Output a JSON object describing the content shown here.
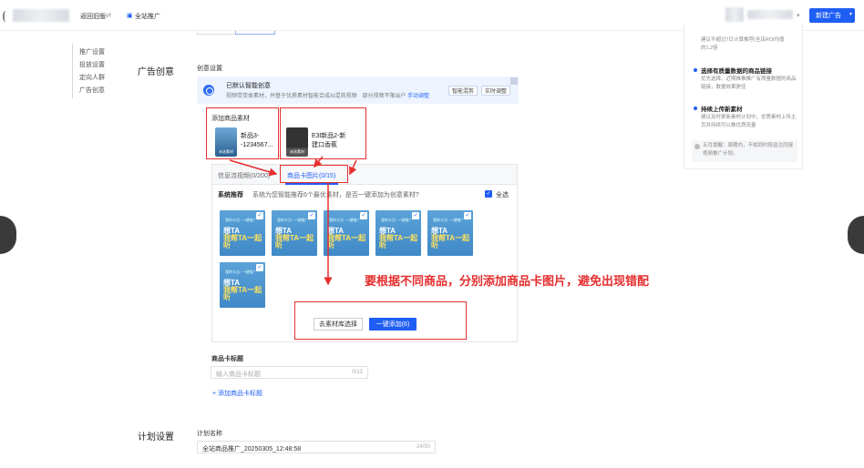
{
  "topbar": {
    "back_label": "返回旧版",
    "scope_label": "全站推广",
    "new_ad_label": "新建广告",
    "dropdown_caret": "▾"
  },
  "nav": {
    "items": [
      "推广设置",
      "投放设置",
      "定向人群",
      "广告创意"
    ]
  },
  "sections": {
    "ad_creative_title": "广告创意",
    "creative_settings_label": "创意设置",
    "plan_settings_title": "计划设置"
  },
  "smart_banner": {
    "title": "已默认智能创意",
    "desc_main": "视频带货类素材，并基于优质素材智能合成AI混剪视频",
    "desc_tail": "部分视频不限出户",
    "desc_link": "手动调整",
    "btn_smart_mix": "智能混剪",
    "btn_realtime": "实时调整"
  },
  "products": {
    "label": "添加商品素材",
    "items": [
      {
        "name_line1": "新品3-",
        "name_line2": "-1234567...",
        "thumb_tag": "未选素材"
      },
      {
        "name_line1": "E3l新品2-新",
        "name_line2": "建口香蕉",
        "thumb_tag": "未选素材"
      }
    ]
  },
  "panel": {
    "tabs": [
      {
        "label": "信息流视频(0/200)"
      },
      {
        "label": "商品卡图片(0/15)"
      }
    ],
    "system_recommend_label": "系统推荐",
    "system_recommend_text": "系统为您智能推荐6个最优素材，是否一键添加为创意素材?",
    "select_all_label": "全选",
    "check_mark": "✓",
    "card": {
      "top_text": "我的卡点: 一键推广 ·",
      "line1": "想TA",
      "line2": "我帮TA一起听"
    },
    "btn_material_library": "去素材库选择",
    "btn_add_all": "一键添加(6)"
  },
  "annotation": "要根据不同商品，分别添加商品卡图片，避免出现错配",
  "card_title": {
    "label": "商品卡标题",
    "placeholder": "输入商品卡标题",
    "counter": "0/13",
    "add_link": "+ 添加商品卡标题"
  },
  "plan": {
    "name_label": "计划名称",
    "name_value": "全站商品推广_20250305_12:48:58",
    "name_counter": "24/50"
  },
  "right_panel": {
    "top_cut_desc": "建议不超过7日计算推荐(全店ROI均值",
    "top_cut_desc2": "的1.2倍",
    "tips": [
      {
        "title": "选择有质量数据的商品链接",
        "desc": "优先选择、近期推推推广有质量数据的商品链接，数据效果更佳"
      },
      {
        "title": "持续上传新素材",
        "desc": "建议及时更新素材计划中，优质素材上传主页并持续可以推优质流量"
      }
    ],
    "note": "五月提醒：周期内，不相同时段监注同报视频推广计划。"
  },
  "colors": {
    "primary": "#1f5ef4",
    "annotation_red": "#e52e2e"
  }
}
